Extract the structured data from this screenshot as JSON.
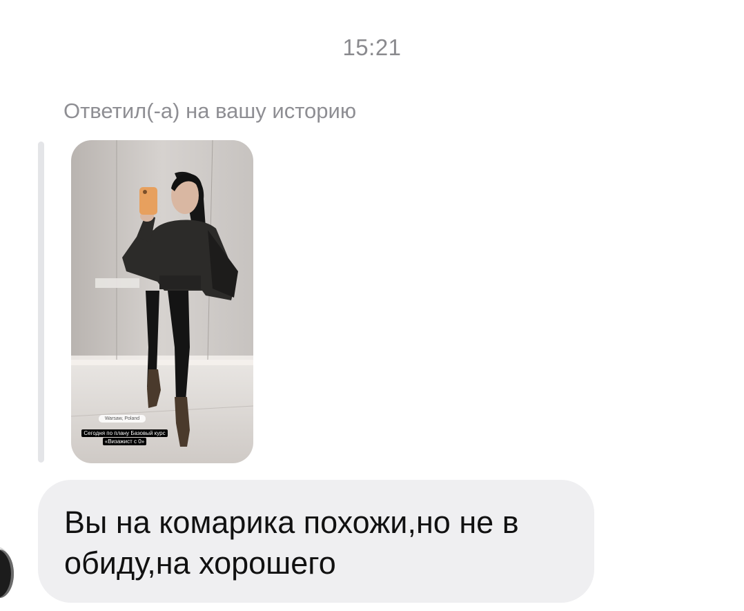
{
  "chat": {
    "timestamp": "15:21",
    "reply_label": "Ответил(-а) на вашу историю",
    "story": {
      "location": "Warsaw, Poland",
      "caption": "Сегодня по плану Базовый курс «Визажист с 0»"
    },
    "message_text": "Вы на комарика похожи,но не в обиду,на хорошего"
  },
  "colors": {
    "background": "#ffffff",
    "bubble": "#efeff1",
    "meta_text": "#8e8e93",
    "message_text": "#111111",
    "quote_bar": "#e4e5e8"
  }
}
